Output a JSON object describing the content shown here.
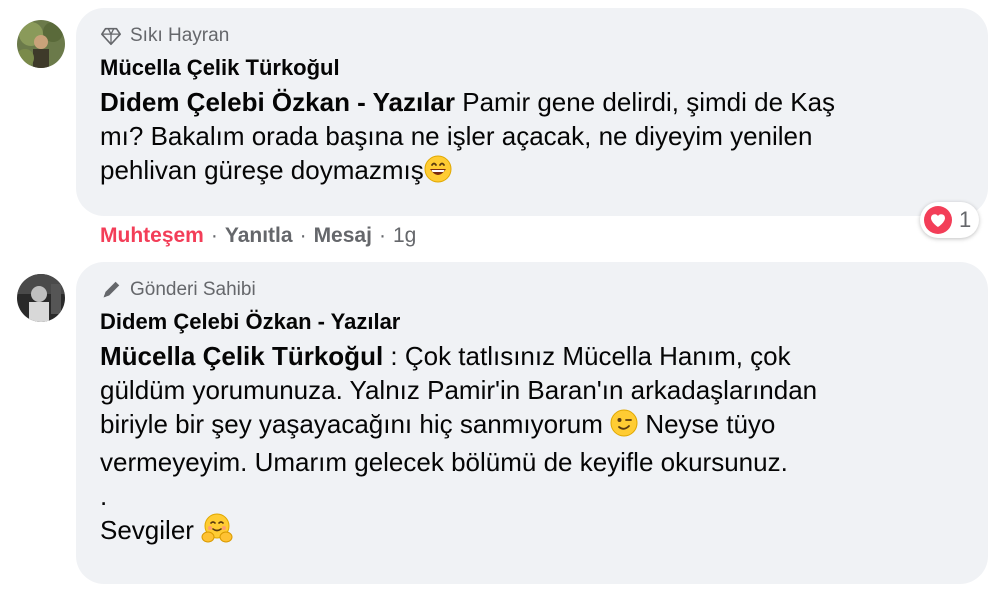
{
  "comment1": {
    "badge": "Sıkı Hayran",
    "author": "Mücella Çelik Türkoğul",
    "mention": "Didem Çelebi Özkan - Yazılar",
    "text_line1": " Pamir gene delirdi, şimdi de Kaş",
    "text_line2": "mı? Bakalım orada başına ne işler açacak, ne diyeyim yenilen",
    "text_line3": "pehlivan güreşe doymazmış",
    "emoji": "grinning-face",
    "actions": {
      "reaction": "Muhteşem",
      "reply": "Yanıtla",
      "message": "Mesaj",
      "time": "1g",
      "separator": "·"
    },
    "reaction_count": "1",
    "reaction_type": "heart-icon"
  },
  "comment2": {
    "badge": "Gönderi Sahibi",
    "author": "Didem Çelebi Özkan - Yazılar",
    "mention": "Mücella Çelik Türkoğul",
    "text_line1": " : Çok tatlısınız Mücella Hanım, çok",
    "text_line2": "güldüm yorumunuza. Yalnız Pamir'in Baran'ın arkadaşlarından",
    "text_line3a": "biriyle bir şey yaşayacağını hiç sanmıyorum ",
    "text_line3b": " Neyse tüyo",
    "text_line4": "vermeyeyim. Umarım gelecek bölümü de keyifle okursunuz.",
    "text_line5": ".",
    "text_line6": "Sevgiler ",
    "emojis": [
      "winking-face",
      "smiling-hands-face"
    ]
  },
  "colors": {
    "bubble": "#f0f2f5",
    "secondary_text": "#65676b",
    "reaction_red": "#f33e58"
  }
}
